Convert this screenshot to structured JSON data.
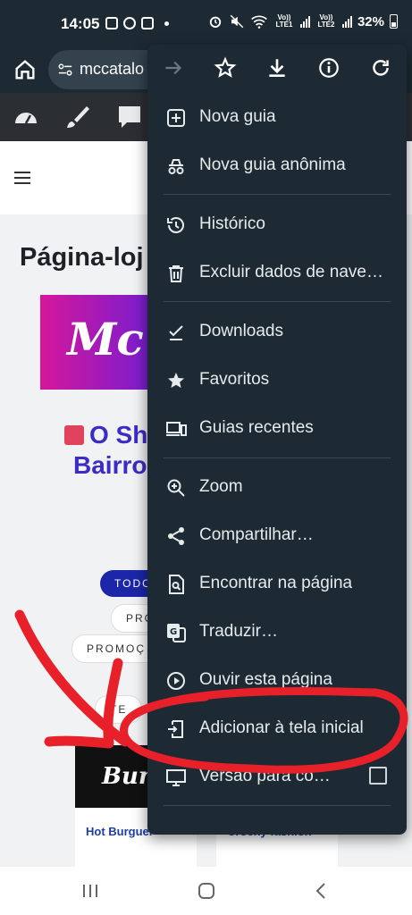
{
  "status_bar": {
    "time": "14:05",
    "battery": "32%",
    "lte1": "Vo)) LTE1",
    "lte2": "Vo)) LTE2"
  },
  "browser": {
    "url": "mccatalo"
  },
  "page": {
    "title": "Página-loj",
    "banner_logo": "Mc",
    "shop_title_line1": "O Sh",
    "shop_title_line2": "Bairro",
    "chips": [
      "TODO",
      "PRO",
      "PROMOÇ",
      "TE"
    ],
    "cards": [
      {
        "label": "Hot Burguer",
        "image_text": "Burg"
      },
      {
        "label": "Crochy fashion"
      }
    ]
  },
  "menu": {
    "items": [
      {
        "label": "Nova guia",
        "icon": "new-tab-icon"
      },
      {
        "label": "Nova guia anônima",
        "icon": "incognito-icon"
      },
      {
        "label": "Histórico",
        "icon": "history-icon"
      },
      {
        "label": "Excluir dados de nave…",
        "icon": "trash-icon"
      },
      {
        "label": "Downloads",
        "icon": "download-check-icon"
      },
      {
        "label": "Favoritos",
        "icon": "star-icon"
      },
      {
        "label": "Guias recentes",
        "icon": "devices-icon"
      },
      {
        "label": "Zoom",
        "icon": "zoom-icon"
      },
      {
        "label": "Compartilhar…",
        "icon": "share-icon"
      },
      {
        "label": "Encontrar na página",
        "icon": "find-in-page-icon"
      },
      {
        "label": "Traduzir…",
        "icon": "translate-icon"
      },
      {
        "label": "Ouvir esta página",
        "icon": "play-icon"
      },
      {
        "label": "Adicionar à tela inicial",
        "icon": "add-to-home-icon"
      },
      {
        "label": "Versão para co…",
        "icon": "desktop-icon"
      }
    ]
  },
  "colors": {
    "menu_bg": "#1d2a33",
    "annotation": "#e8202a",
    "accent": "#1b27a8"
  }
}
